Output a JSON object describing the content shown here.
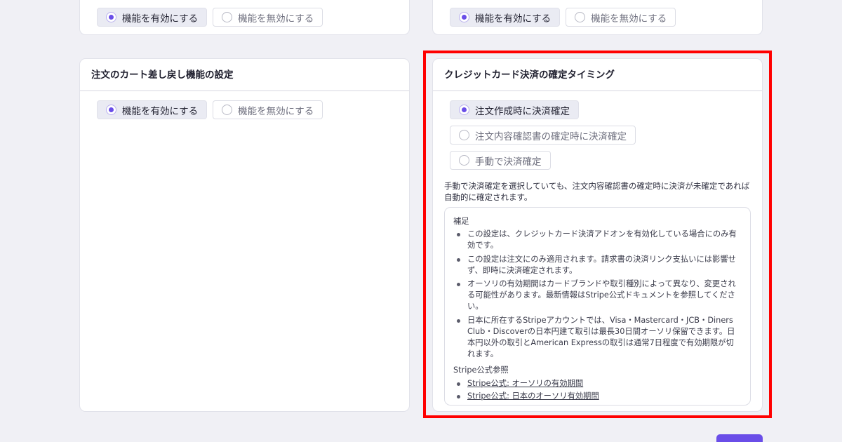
{
  "top_left_card": {
    "options": [
      "機能を有効にする",
      "機能を無効にする"
    ],
    "selected_index": 0
  },
  "top_right_card": {
    "options": [
      "機能を有効にする",
      "機能を無効にする"
    ],
    "selected_index": 0
  },
  "cart_revert_card": {
    "title": "注文のカート差し戻し機能の設定",
    "options": [
      "機能を有効にする",
      "機能を無効にする"
    ],
    "selected_index": 0
  },
  "payment_timing_card": {
    "title": "クレジットカード決済の確定タイミング",
    "options": [
      "注文作成時に決済確定",
      "注文内容確認書の確定時に決済確定",
      "手動で決済確定"
    ],
    "selected_index": 0,
    "description": "手動で決済確定を選択していても、注文内容確認書の確定時に決済が未確定であれば自動的に確定されます。",
    "notes": {
      "title": "補足",
      "items": [
        "この設定は、クレジットカード決済アドオンを有効化している場合にのみ有効です。",
        "この設定は注文にのみ適用されます。請求書の決済リンク支払いには影響せず、即時に決済確定されます。",
        "オーソリの有効期間はカードブランドや取引種別によって異なり、変更される可能性があります。最新情報はStripe公式ドキュメントを参照してください。",
        "日本に所在するStripeアカウントでは、Visa・Mastercard・JCB・Diners Club・Discoverの日本円建て取引は最長30日間オーソリ保留できます。日本円以外の取引とAmerican Expressの取引は通常7日程度で有効期限が切れます。"
      ],
      "references_title": "Stripe公式参照",
      "references": [
        "Stripe公式: オーソリの有効期間",
        "Stripe公式: 日本のオーソリ有効期間"
      ]
    }
  },
  "colors": {
    "accent": "#6a4ee8",
    "highlight_border": "#ff0000",
    "background": "#f0f0f5"
  }
}
